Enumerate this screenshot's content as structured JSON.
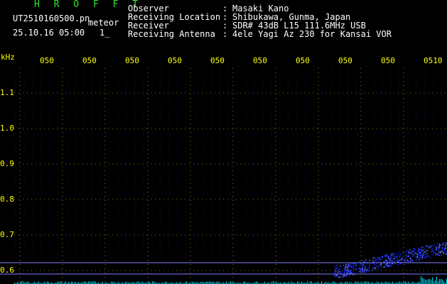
{
  "header": {
    "app_name": "H R O F F T",
    "file_name": "UT2510160500.pn",
    "file_tag": "meteor",
    "datetime": "25.10.16 05:00",
    "page_marker": "1_",
    "fields": [
      {
        "label": "Observer",
        "sep": ":",
        "value": "Masaki Kano"
      },
      {
        "label": "Receiving Location",
        "sep": ":",
        "value": "Shibukawa, Gunma, Japan"
      },
      {
        "label": "Receiver",
        "sep": ":",
        "value": "SDR# 43dB L15 111.6MHz USB"
      },
      {
        "label": "Receiving Antenna",
        "sep": ":",
        "value": "4ele Yagi Az 230 for Kansai VOR"
      }
    ]
  },
  "axis": {
    "y_unit": "kHz",
    "y_ticks": [
      {
        "label": "1.1",
        "value": 1.1
      },
      {
        "label": "1.0",
        "value": 1.0
      },
      {
        "label": "0.9",
        "value": 0.9
      },
      {
        "label": "0.8",
        "value": 0.8
      },
      {
        "label": "0.7",
        "value": 0.7
      },
      {
        "label": "0.6",
        "value": 0.6
      }
    ],
    "x_ticks": [
      "050",
      "050",
      "050",
      "050",
      "050",
      "050",
      "050",
      "050",
      "050",
      "0510"
    ]
  },
  "colors": {
    "background": "#000000",
    "grid": "#ffff00",
    "header_text": "#ffffff",
    "app_name": "#2ee82e",
    "signal_low": "#1a2cff",
    "spectrum": "#00e5ff"
  }
}
